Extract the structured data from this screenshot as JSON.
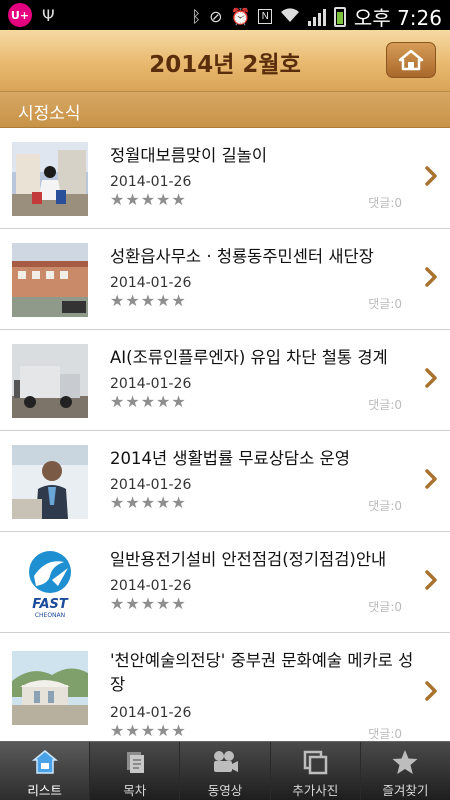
{
  "status_bar": {
    "time": "오후 7:26",
    "carrier_logo": "U+",
    "icons": [
      "usb-icon",
      "bluetooth-icon",
      "mute-icon",
      "alarm-icon",
      "nfc-icon",
      "wifi-icon",
      "signal-icon",
      "battery-icon"
    ]
  },
  "header": {
    "title": "2014년 2월호",
    "home_icon": "home-icon"
  },
  "section": {
    "title": "시정소식"
  },
  "items": [
    {
      "title": "정월대보름맞이 길놀이",
      "date": "2014-01-26",
      "comments": "댓글:0",
      "rating": 0
    },
    {
      "title": "성환읍사무소 · 청룡동주민센터 새단장",
      "date": "2014-01-26",
      "comments": "댓글:0",
      "rating": 0
    },
    {
      "title": "AI(조류인플루엔자) 유입 차단 철통 경계",
      "date": "2014-01-26",
      "comments": "댓글:0",
      "rating": 0
    },
    {
      "title": "2014년 생활법률 무료상담소 운영",
      "date": "2014-01-26",
      "comments": "댓글:0",
      "rating": 0
    },
    {
      "title": "일반용전기설비 안전점검(정기점검)안내",
      "date": "2014-01-26",
      "comments": "댓글:0",
      "rating": 0,
      "logo_text": "FAST",
      "logo_sub": "CHEONAN"
    },
    {
      "title": "'천안예술의전당' 중부권 문화예술 메카로 성장",
      "date": "2014-01-26",
      "comments": "댓글:0",
      "rating": 0
    }
  ],
  "bottom_nav": [
    {
      "label": "리스트",
      "icon": "list-home-icon",
      "active": true
    },
    {
      "label": "목차",
      "icon": "document-icon",
      "active": false
    },
    {
      "label": "동영상",
      "icon": "video-camera-icon",
      "active": false
    },
    {
      "label": "추가사진",
      "icon": "photos-icon",
      "active": false
    },
    {
      "label": "즐겨찾기",
      "icon": "star-icon",
      "active": false
    }
  ],
  "colors": {
    "header_brown": "#5a2d0c",
    "section_tan": "#c79347",
    "chevron": "#a8722f"
  }
}
